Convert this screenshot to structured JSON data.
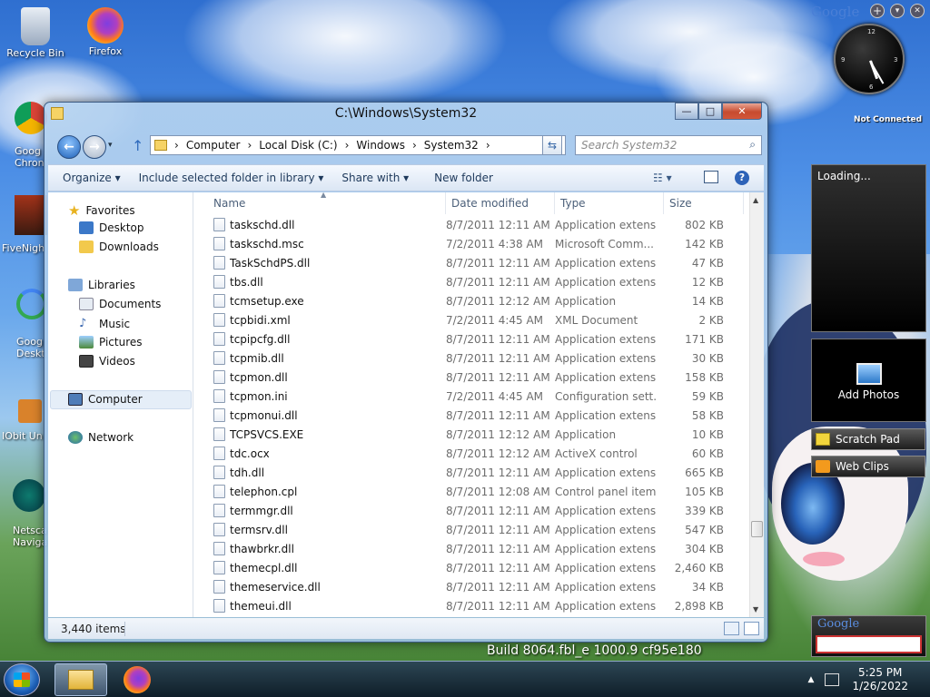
{
  "desktop": {
    "icons": [
      {
        "label": "Recycle Bin",
        "icon": "recycle-bin-icon"
      },
      {
        "label": "Firefox",
        "icon": "firefox-icon"
      }
    ],
    "partial_icons": [
      {
        "line1": "Goog",
        "line2": "Chron",
        "icon": "chrome-icon"
      },
      {
        "line1": "FiveNigh",
        "line2": "",
        "icon": "fnaf-icon"
      },
      {
        "line1": "Goog",
        "line2": "Deskt",
        "icon": "google-desktop-icon"
      },
      {
        "line1": "IObit Un",
        "line2": "",
        "icon": "iobit-icon"
      },
      {
        "line1": "Netsca",
        "line2": "Naviga",
        "icon": "netscape-icon"
      }
    ],
    "build_text": "Build 8064.fbl_e 1000.9 cf95e180"
  },
  "gadgets": {
    "google_logo": "Google",
    "clock_status": "Not Connected",
    "loading": "Loading...",
    "add_photos": "Add Photos",
    "scratch_pad": "Scratch Pad",
    "web_clips": "Web Clips",
    "google_search_logo": "Google",
    "google_search_value": ""
  },
  "window": {
    "title": "C:\\Windows\\System32",
    "minimize": "—",
    "maximize": "□",
    "close": "✕",
    "breadcrumb": [
      "Computer",
      "Local Disk (C:)",
      "Windows",
      "System32"
    ],
    "search_placeholder": "Search System32",
    "toolbar": {
      "organize": "Organize ▾",
      "include": "Include selected folder in library ▾",
      "share": "Share with ▾",
      "new_folder": "New folder"
    },
    "nav": {
      "favorites": "Favorites",
      "desktop": "Desktop",
      "downloads": "Downloads",
      "libraries": "Libraries",
      "documents": "Documents",
      "music": "Music",
      "pictures": "Pictures",
      "videos": "Videos",
      "computer": "Computer",
      "network": "Network"
    },
    "columns": {
      "name": "Name",
      "date": "Date modified",
      "type": "Type",
      "size": "Size"
    },
    "files": [
      {
        "name": "taskschd.dll",
        "date": "8/7/2011 12:11 AM",
        "type": "Application extens...",
        "size": "802 KB"
      },
      {
        "name": "taskschd.msc",
        "date": "7/2/2011 4:38 AM",
        "type": "Microsoft Comm...",
        "size": "142 KB"
      },
      {
        "name": "TaskSchdPS.dll",
        "date": "8/7/2011 12:11 AM",
        "type": "Application extens...",
        "size": "47 KB"
      },
      {
        "name": "tbs.dll",
        "date": "8/7/2011 12:11 AM",
        "type": "Application extens...",
        "size": "12 KB"
      },
      {
        "name": "tcmsetup.exe",
        "date": "8/7/2011 12:12 AM",
        "type": "Application",
        "size": "14 KB"
      },
      {
        "name": "tcpbidi.xml",
        "date": "7/2/2011 4:45 AM",
        "type": "XML Document",
        "size": "2 KB"
      },
      {
        "name": "tcpipcfg.dll",
        "date": "8/7/2011 12:11 AM",
        "type": "Application extens...",
        "size": "171 KB"
      },
      {
        "name": "tcpmib.dll",
        "date": "8/7/2011 12:11 AM",
        "type": "Application extens...",
        "size": "30 KB"
      },
      {
        "name": "tcpmon.dll",
        "date": "8/7/2011 12:11 AM",
        "type": "Application extens...",
        "size": "158 KB"
      },
      {
        "name": "tcpmon.ini",
        "date": "7/2/2011 4:45 AM",
        "type": "Configuration sett...",
        "size": "59 KB"
      },
      {
        "name": "tcpmonui.dll",
        "date": "8/7/2011 12:11 AM",
        "type": "Application extens...",
        "size": "58 KB"
      },
      {
        "name": "TCPSVCS.EXE",
        "date": "8/7/2011 12:12 AM",
        "type": "Application",
        "size": "10 KB"
      },
      {
        "name": "tdc.ocx",
        "date": "8/7/2011 12:12 AM",
        "type": "ActiveX control",
        "size": "60 KB"
      },
      {
        "name": "tdh.dll",
        "date": "8/7/2011 12:11 AM",
        "type": "Application extens...",
        "size": "665 KB"
      },
      {
        "name": "telephon.cpl",
        "date": "8/7/2011 12:08 AM",
        "type": "Control panel item",
        "size": "105 KB"
      },
      {
        "name": "termmgr.dll",
        "date": "8/7/2011 12:11 AM",
        "type": "Application extens...",
        "size": "339 KB"
      },
      {
        "name": "termsrv.dll",
        "date": "8/7/2011 12:11 AM",
        "type": "Application extens...",
        "size": "547 KB"
      },
      {
        "name": "thawbrkr.dll",
        "date": "8/7/2011 12:11 AM",
        "type": "Application extens...",
        "size": "304 KB"
      },
      {
        "name": "themecpl.dll",
        "date": "8/7/2011 12:11 AM",
        "type": "Application extens...",
        "size": "2,460 KB"
      },
      {
        "name": "themeservice.dll",
        "date": "8/7/2011 12:11 AM",
        "type": "Application extens...",
        "size": "34 KB"
      },
      {
        "name": "themeui.dll",
        "date": "8/7/2011 12:11 AM",
        "type": "Application extens...",
        "size": "2,898 KB"
      }
    ],
    "status": "3,440 items"
  },
  "taskbar": {
    "time": "5:25 PM",
    "date": "1/26/2022"
  }
}
